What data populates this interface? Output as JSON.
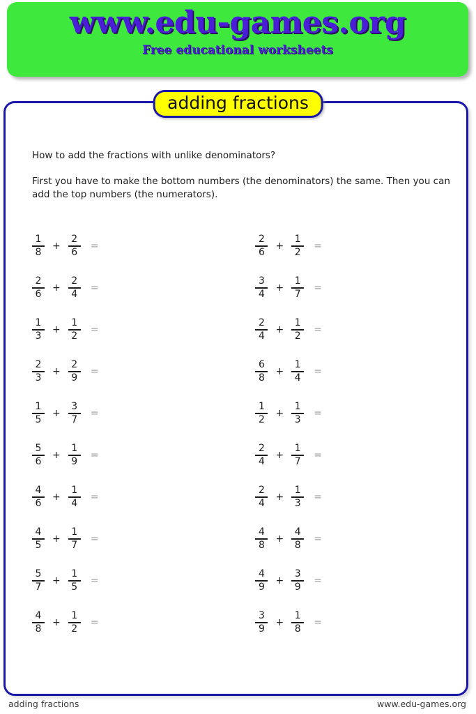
{
  "header": {
    "logo": "www.edu-games.org",
    "tagline": "Free educational worksheets",
    "banner_color": "#3ee83c",
    "logo_color": "#4a1ed6"
  },
  "title_pill": {
    "label": "adding fractions",
    "fill_color": "#ffff00",
    "border_color": "#1a18a8"
  },
  "instructions": {
    "question": "How to add the fractions with unlike denominators?",
    "explanation": "First you have to make the bottom numbers (the denominators) the same. Then you can add the top numbers (the numerators)."
  },
  "symbols": {
    "plus": "+",
    "equals": "="
  },
  "problems": {
    "rows": [
      {
        "left": {
          "a_num": "1",
          "a_den": "8",
          "b_num": "2",
          "b_den": "6"
        },
        "right": {
          "a_num": "2",
          "a_den": "6",
          "b_num": "1",
          "b_den": "2"
        }
      },
      {
        "left": {
          "a_num": "2",
          "a_den": "6",
          "b_num": "2",
          "b_den": "4"
        },
        "right": {
          "a_num": "3",
          "a_den": "4",
          "b_num": "1",
          "b_den": "7"
        }
      },
      {
        "left": {
          "a_num": "1",
          "a_den": "3",
          "b_num": "1",
          "b_den": "2"
        },
        "right": {
          "a_num": "2",
          "a_den": "4",
          "b_num": "1",
          "b_den": "2"
        }
      },
      {
        "left": {
          "a_num": "2",
          "a_den": "3",
          "b_num": "2",
          "b_den": "9"
        },
        "right": {
          "a_num": "6",
          "a_den": "8",
          "b_num": "1",
          "b_den": "4"
        }
      },
      {
        "left": {
          "a_num": "1",
          "a_den": "5",
          "b_num": "3",
          "b_den": "7"
        },
        "right": {
          "a_num": "1",
          "a_den": "2",
          "b_num": "1",
          "b_den": "3"
        }
      },
      {
        "left": {
          "a_num": "5",
          "a_den": "6",
          "b_num": "1",
          "b_den": "9"
        },
        "right": {
          "a_num": "2",
          "a_den": "4",
          "b_num": "1",
          "b_den": "7"
        }
      },
      {
        "left": {
          "a_num": "4",
          "a_den": "6",
          "b_num": "1",
          "b_den": "4"
        },
        "right": {
          "a_num": "2",
          "a_den": "4",
          "b_num": "1",
          "b_den": "3"
        }
      },
      {
        "left": {
          "a_num": "4",
          "a_den": "5",
          "b_num": "1",
          "b_den": "7"
        },
        "right": {
          "a_num": "4",
          "a_den": "8",
          "b_num": "4",
          "b_den": "8"
        }
      },
      {
        "left": {
          "a_num": "5",
          "a_den": "7",
          "b_num": "1",
          "b_den": "5"
        },
        "right": {
          "a_num": "4",
          "a_den": "9",
          "b_num": "3",
          "b_den": "9"
        }
      },
      {
        "left": {
          "a_num": "4",
          "a_den": "8",
          "b_num": "1",
          "b_den": "2"
        },
        "right": {
          "a_num": "3",
          "a_den": "9",
          "b_num": "1",
          "b_den": "8"
        }
      }
    ]
  },
  "footer": {
    "left": "adding fractions",
    "right": "www.edu-games.org"
  }
}
